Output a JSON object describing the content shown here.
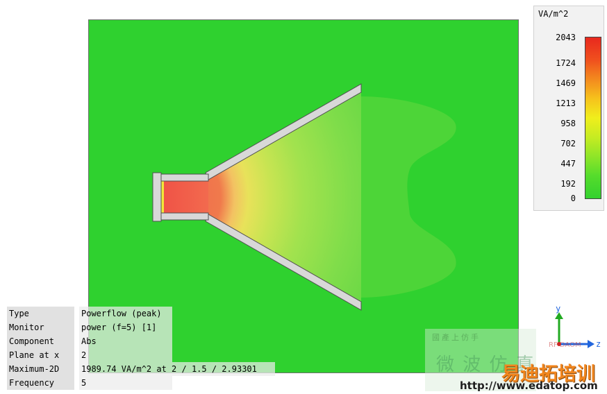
{
  "legend": {
    "unit": "VA/m^2",
    "ticks": [
      "2043",
      "1724",
      "1469",
      "1213",
      "958",
      "702",
      "447",
      "192",
      "0"
    ]
  },
  "info": {
    "rows": [
      {
        "key": "Type",
        "value": "Powerflow (peak)"
      },
      {
        "key": "Monitor",
        "value": "power (f=5) [1]"
      },
      {
        "key": "Component",
        "value": "Abs"
      },
      {
        "key": "Plane at x",
        "value": "2"
      },
      {
        "key": "Maximum-2D",
        "value": "1989.74 VA/m^2 at 2 / 1.5 / 2.93301"
      },
      {
        "key": "Frequency",
        "value": "5"
      }
    ]
  },
  "axes": {
    "y_label": "y",
    "z_label": "z"
  },
  "watermark": {
    "line1": "國產上仿手",
    "line2": "微 波 仿 真",
    "brand": "易迪拓培训",
    "url": "http://www.edatop.com",
    "small": "RF·DAOM"
  },
  "colors": {
    "background_field": "#2fd12f",
    "horn_wall": "#d8d8d8",
    "hot": "#f06050"
  }
}
